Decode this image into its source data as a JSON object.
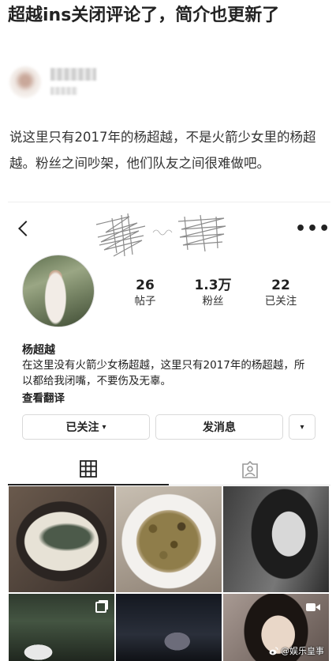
{
  "article": {
    "title": "超越ins关闭评论了，简介也更新了",
    "body": "说这里只有2017年的杨超越，不是火箭少女里的杨超越。粉丝之间吵架，他们队友之间很难做吧。"
  },
  "profile": {
    "stats": [
      {
        "value": "26",
        "label": "帖子"
      },
      {
        "value": "1.3万",
        "label": "粉丝"
      },
      {
        "value": "22",
        "label": "已关注"
      }
    ],
    "name": "杨超越",
    "bio": "在这里没有火箭少女杨超越，这里只有2017年的杨超越，所以都给我闭嘴，不要伤及无辜。",
    "see_translation": "查看翻译"
  },
  "actions": {
    "following_label": "已关注",
    "message_label": "发消息"
  },
  "icons": {
    "back": "back-chevron-icon",
    "more": "more-options-icon",
    "grid": "grid-icon",
    "tagged": "tagged-user-icon",
    "multi": "multiple-photos-icon",
    "video": "video-icon",
    "weibo": "weibo-logo-icon"
  },
  "watermark": "@娱乐皇事"
}
